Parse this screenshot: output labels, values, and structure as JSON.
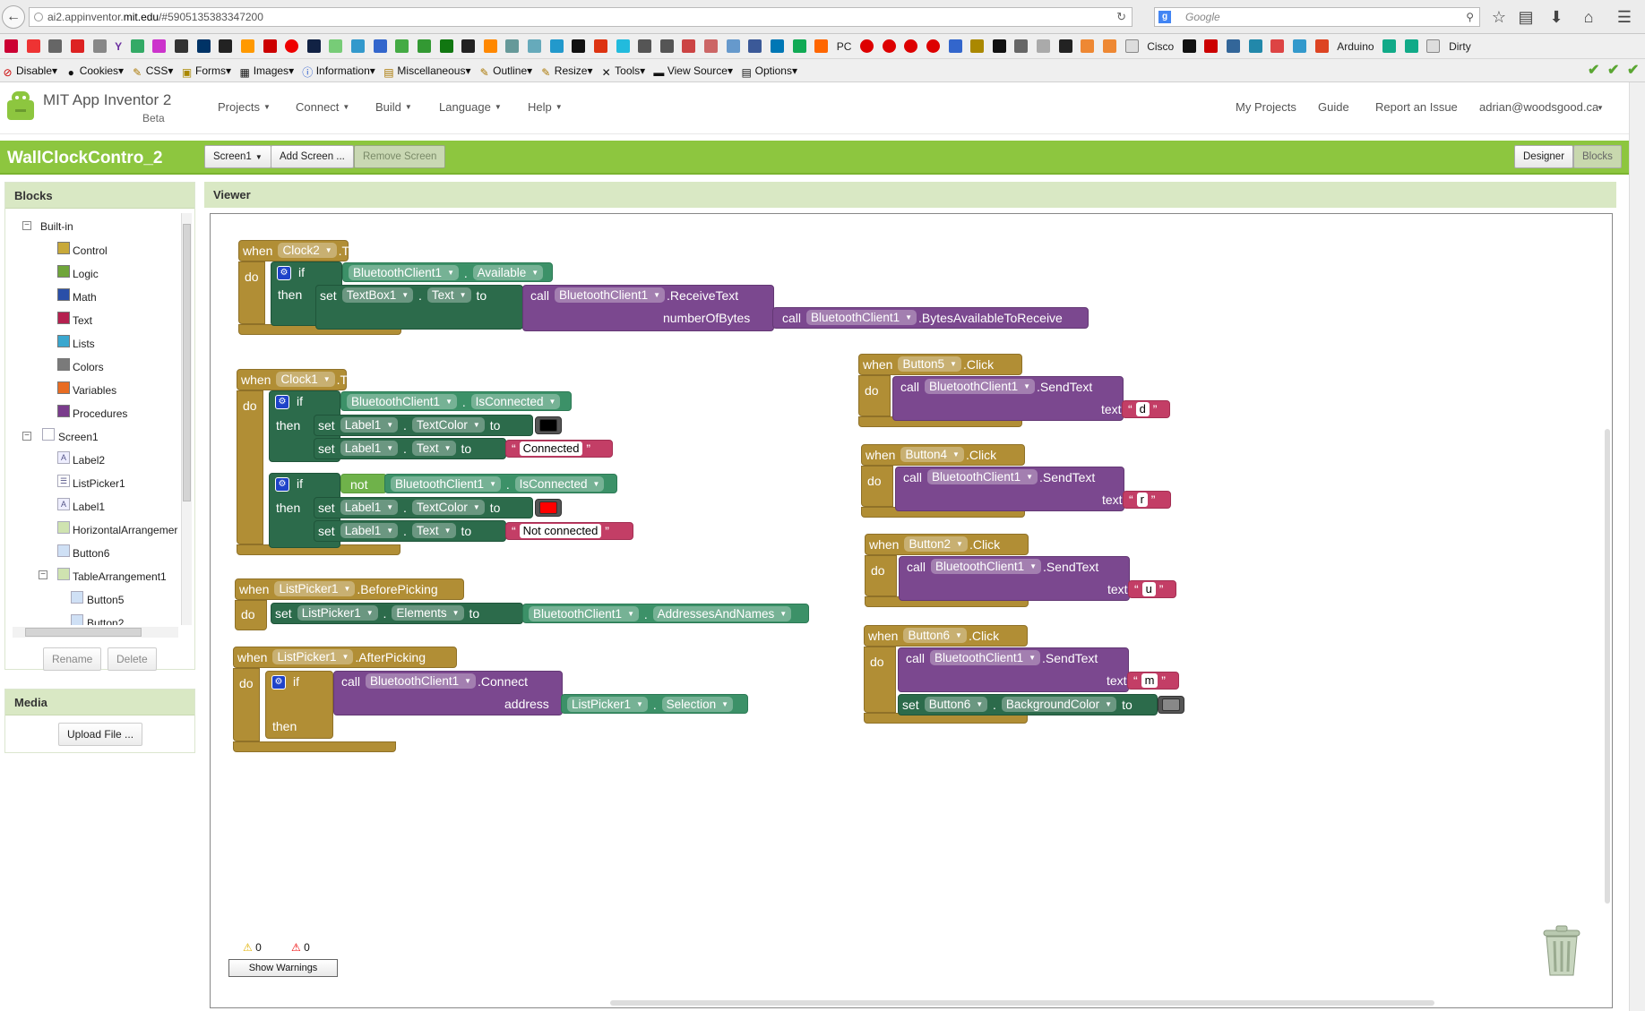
{
  "browser": {
    "url_prefix": "ai2.appinventor.",
    "url_domain": "mit.edu",
    "url_path": "/#5905135383347200",
    "search_placeholder": "Google",
    "search_engine_icon": "g"
  },
  "bookmarks": [
    "Y",
    "Cisco",
    "Arduino",
    "Dirty",
    "PC"
  ],
  "devtools": {
    "items": [
      "Disable",
      "Cookies",
      "CSS",
      "Forms",
      "Images",
      "Information",
      "Miscellaneous",
      "Outline",
      "Resize",
      "Tools",
      "View Source",
      "Options"
    ]
  },
  "app": {
    "title": "MIT App Inventor 2",
    "beta": "Beta",
    "menus": [
      "Projects",
      "Connect",
      "Build",
      "Language",
      "Help"
    ],
    "right_links": [
      "My Projects",
      "Guide",
      "Report an Issue",
      "adrian@woodsgood.ca"
    ]
  },
  "project": {
    "name": "WallClockContro_2",
    "screen_select": "Screen1",
    "add_screen": "Add Screen ...",
    "remove_screen": "Remove Screen",
    "designer": "Designer",
    "blocks": "Blocks"
  },
  "blocks_panel": {
    "title": "Blocks",
    "builtin": "Built-in",
    "builtin_items": [
      {
        "label": "Control",
        "color": "#c8a93a"
      },
      {
        "label": "Logic",
        "color": "#6fa53a"
      },
      {
        "label": "Math",
        "color": "#2a4fa8"
      },
      {
        "label": "Text",
        "color": "#b5204f"
      },
      {
        "label": "Lists",
        "color": "#3aa7cf"
      },
      {
        "label": "Colors",
        "color": "#7a7a7a"
      },
      {
        "label": "Variables",
        "color": "#e86c22"
      },
      {
        "label": "Procedures",
        "color": "#7a3c8c"
      }
    ],
    "screen": "Screen1",
    "components": [
      "Label2",
      "ListPicker1",
      "Label1",
      "HorizontalArrangemer",
      "Button6"
    ],
    "table": "TableArrangement1",
    "table_children": [
      "Button5",
      "Button2"
    ],
    "rename": "Rename",
    "delete": "Delete"
  },
  "media": {
    "title": "Media",
    "upload": "Upload File ..."
  },
  "viewer": {
    "title": "Viewer"
  },
  "kw": {
    "when": "when",
    "do": "do",
    "if": "if",
    "then": "then",
    "set": "set",
    "to": "to",
    "call": "call",
    "not": "not",
    "text": "text",
    "address": "address",
    "numberOfBytes": "numberOfBytes"
  },
  "code": {
    "clock2": {
      "comp": "Clock2",
      "evt": ".Timer",
      "bt": "BluetoothClient1",
      "avail": "Available",
      "tb": "TextBox1",
      "prop": "Text",
      "recv": ".ReceiveText",
      "bytes": ".BytesAvailableToReceive"
    },
    "clock1": {
      "comp": "Clock1",
      "evt": ".Timer",
      "bt": "BluetoothClient1",
      "isconn": "IsConnected",
      "label": "Label1",
      "textcolor": "TextColor",
      "text": "Text",
      "connected": "Connected",
      "notconnected": "Not connected"
    },
    "lp_before": {
      "comp": "ListPicker1",
      "evt": ".BeforePicking",
      "prop": "Elements",
      "bt": "BluetoothClient1",
      "addr": "AddressesAndNames"
    },
    "lp_after": {
      "comp": "ListPicker1",
      "evt": ".AfterPicking",
      "bt": "BluetoothClient1",
      "connect": ".Connect",
      "sel": "Selection"
    },
    "b5": {
      "comp": "Button5",
      "evt": ".Click",
      "bt": "BluetoothClient1",
      "send": ".SendText",
      "val": "d"
    },
    "b4": {
      "comp": "Button4",
      "evt": ".Click",
      "bt": "BluetoothClient1",
      "send": ".SendText",
      "val": "r"
    },
    "b2": {
      "comp": "Button2",
      "evt": ".Click",
      "bt": "BluetoothClient1",
      "send": ".SendText",
      "val": "u"
    },
    "b6": {
      "comp": "Button6",
      "evt": ".Click",
      "bt": "BluetoothClient1",
      "send": ".SendText",
      "val": "m",
      "prop": "BackgroundColor"
    },
    "colors": {
      "black": "#000000",
      "red": "#ff0000",
      "gray": "#888888"
    }
  },
  "warnings": {
    "warn_count": "0",
    "error_count": "0",
    "button": "Show Warnings"
  }
}
